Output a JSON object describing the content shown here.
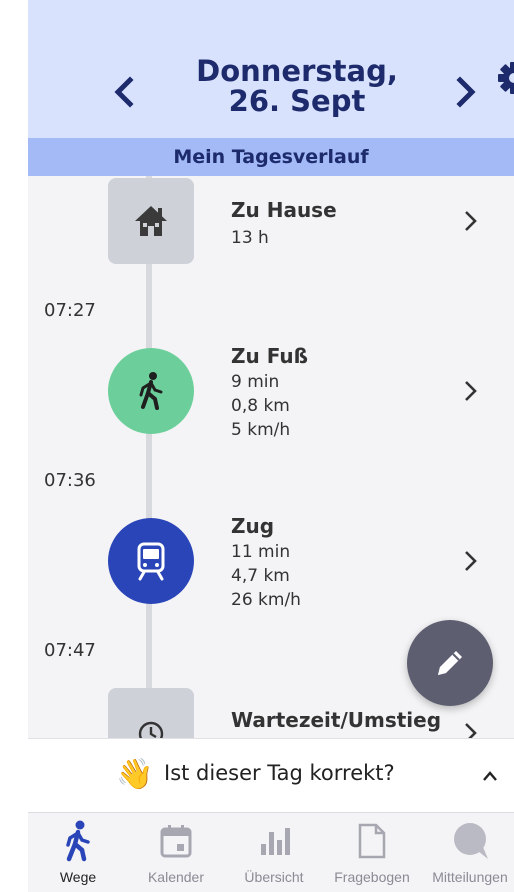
{
  "header": {
    "date_line1": "Donnerstag,",
    "date_line2": "26. Sept",
    "prev_icon": "chevron-left-icon",
    "next_icon": "chevron-right-icon",
    "settings_icon": "gear-icon"
  },
  "subheader": {
    "title": "Mein Tagesverlauf"
  },
  "timeline": {
    "times": [
      "07:27",
      "07:36",
      "07:47"
    ],
    "entries": [
      {
        "icon": "house-icon",
        "title": "Zu Hause",
        "details": [
          "13 h"
        ]
      },
      {
        "icon": "walking-icon",
        "title": "Zu Fuß",
        "details": [
          "9 min",
          "0,8 km",
          "5 km/h"
        ]
      },
      {
        "icon": "train-icon",
        "title": "Zug",
        "details": [
          "11 min",
          "4,7 km",
          "26 km/h"
        ]
      },
      {
        "icon": "clock-icon",
        "title": "Wartezeit/Umstieg",
        "details": []
      }
    ]
  },
  "fab": {
    "icon": "pencil-icon"
  },
  "confirm": {
    "emoji": "👋",
    "text": "Ist dieser Tag korrekt?",
    "toggle_icon": "chevron-up-icon"
  },
  "tabs": [
    {
      "label": "Wege",
      "icon": "walking-icon",
      "active": true
    },
    {
      "label": "Kalender",
      "icon": "calendar-icon",
      "active": false
    },
    {
      "label": "Übersicht",
      "icon": "bar-chart-icon",
      "active": false
    },
    {
      "label": "Fragebogen",
      "icon": "document-icon",
      "active": false
    },
    {
      "label": "Mitteilungen",
      "icon": "chat-bubble-icon",
      "active": false
    }
  ],
  "colors": {
    "header_bg": "#d9e2fd",
    "subheader_bg": "#a3baf7",
    "title_text": "#1d2a6b",
    "walk_green": "#6ccf9b",
    "train_blue": "#2a45b8",
    "active_tab": "#2a45b8",
    "fab_bg": "#5d5f70"
  }
}
